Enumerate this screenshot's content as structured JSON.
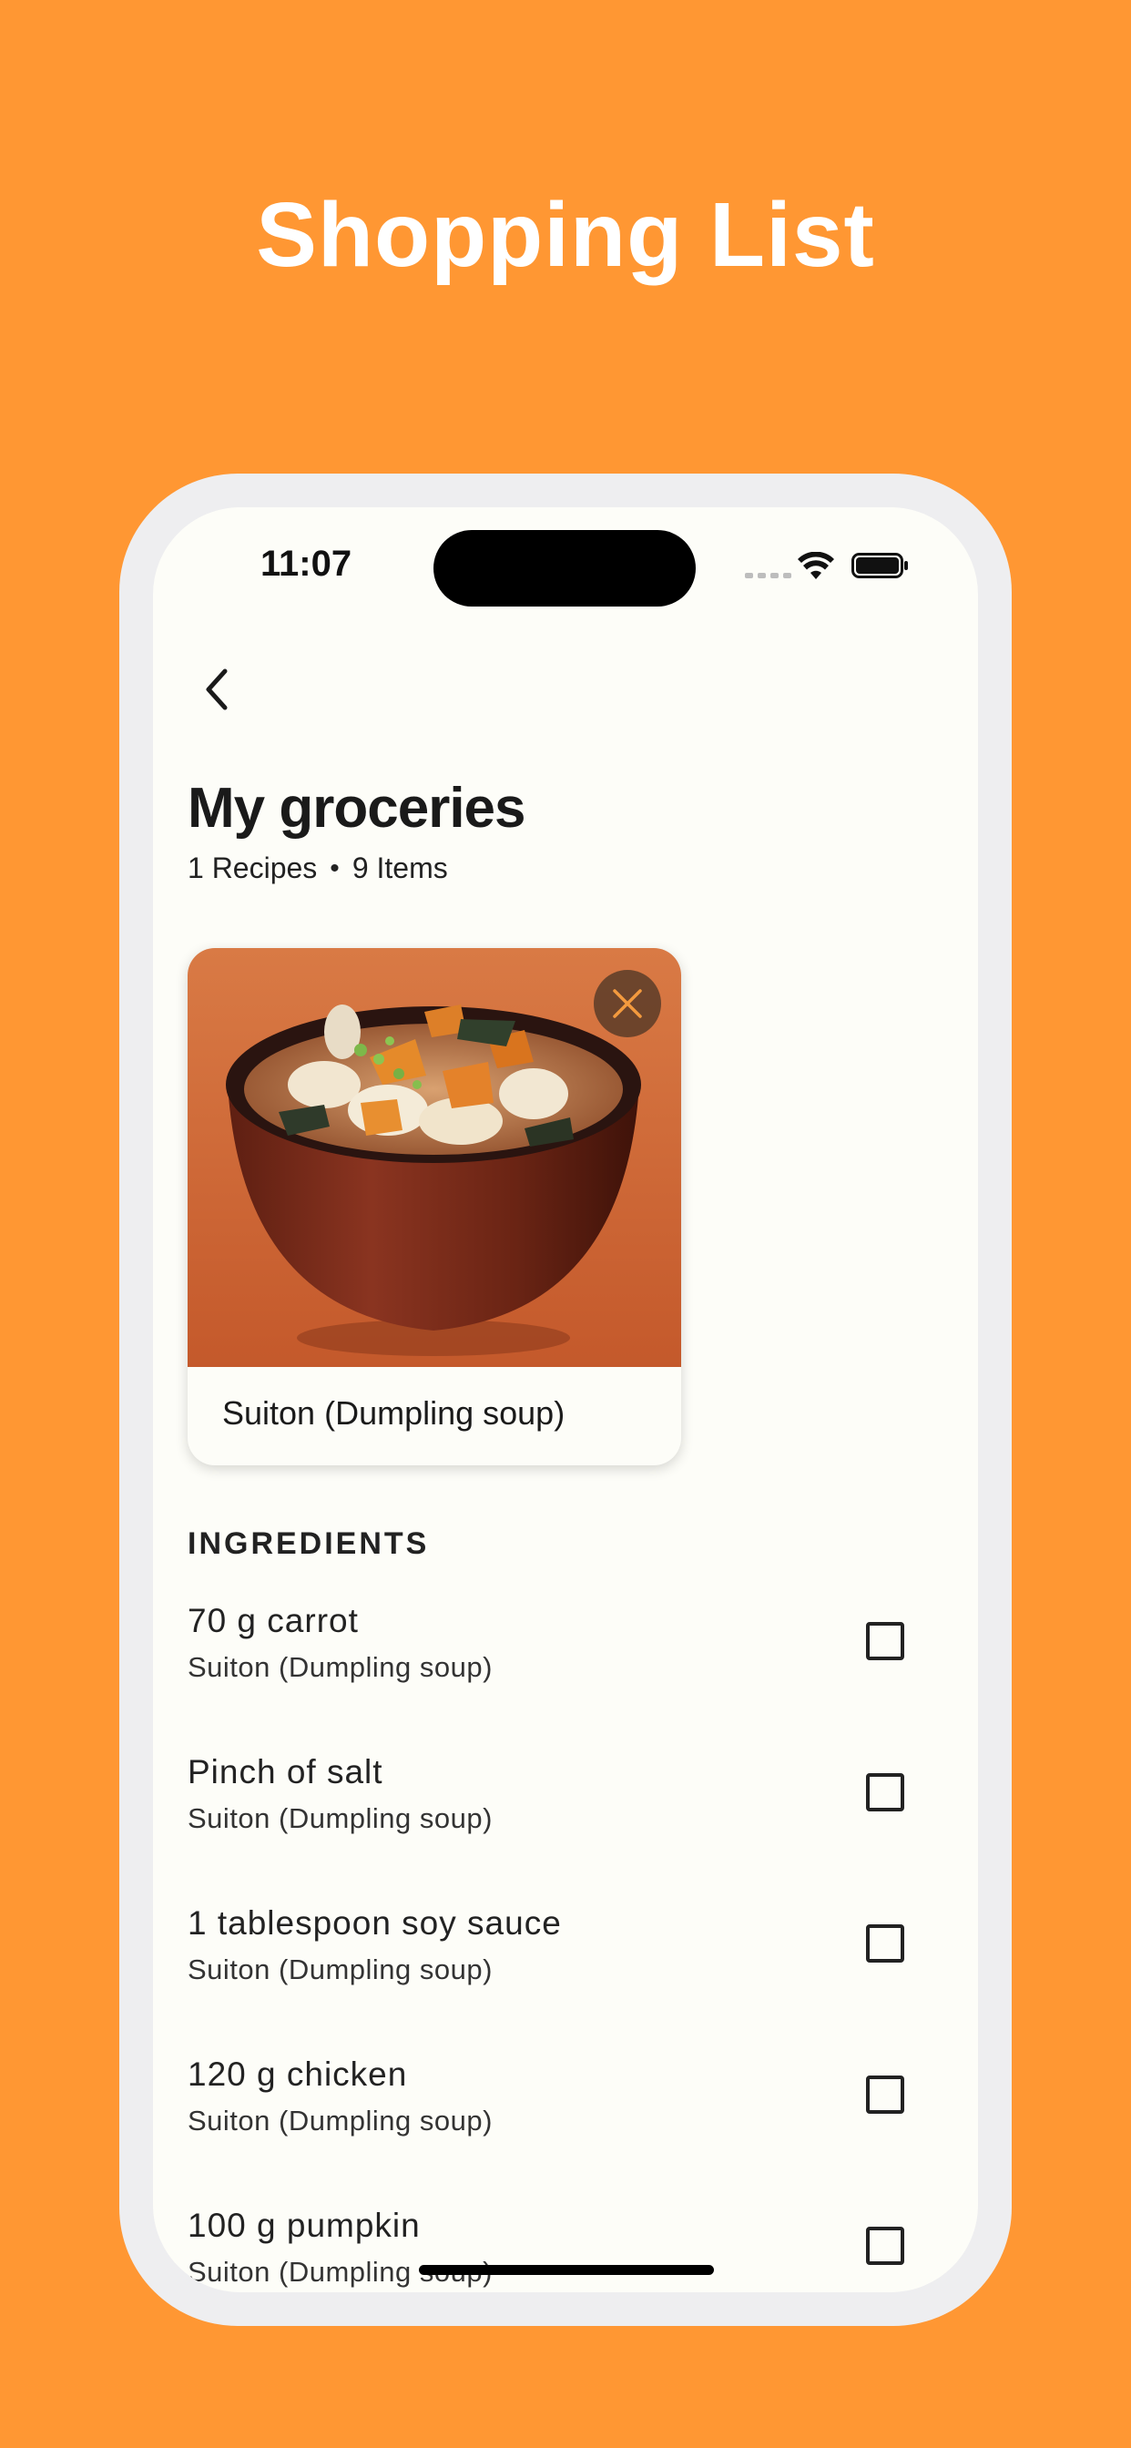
{
  "promo": {
    "title": "Shopping List"
  },
  "status_bar": {
    "time": "11:07",
    "icons": [
      "signal-dots-icon",
      "wifi-icon",
      "battery-icon"
    ]
  },
  "header": {
    "back_icon": "chevron-left-icon",
    "title": "My groceries",
    "recipes_count": "1 Recipes",
    "separator": "•",
    "items_count": "9 Items"
  },
  "recipe_card": {
    "name": "Suiton (Dumpling soup)",
    "remove_icon": "close-icon"
  },
  "ingredients": {
    "heading": "INGREDIENTS",
    "items": [
      {
        "name": "70 g carrot",
        "recipe": "Suiton (Dumpling soup)",
        "checked": false
      },
      {
        "name": "Pinch of salt",
        "recipe": "Suiton (Dumpling soup)",
        "checked": false
      },
      {
        "name": "1 tablespoon soy sauce",
        "recipe": "Suiton (Dumpling soup)",
        "checked": false
      },
      {
        "name": "120 g chicken",
        "recipe": "Suiton (Dumpling soup)",
        "checked": false
      },
      {
        "name": "100 g pumpkin",
        "recipe": "Suiton (Dumpling soup)",
        "checked": false
      }
    ]
  },
  "colors": {
    "background": "#FF9733",
    "screen": "#FDFDF8",
    "frame": "#EEEEF0",
    "accent": "#F39A3E"
  }
}
